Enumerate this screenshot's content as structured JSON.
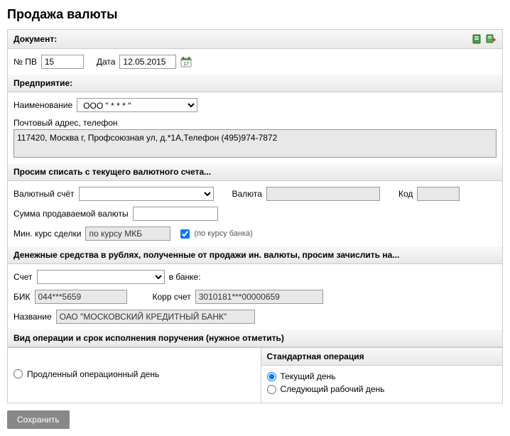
{
  "title": "Продажа валюты",
  "document": {
    "header": "Документ:",
    "numLabel": "№ ПВ",
    "numValue": "15",
    "dateLabel": "Дата",
    "dateValue": "12.05.2015"
  },
  "enterprise": {
    "header": "Предприятие:",
    "nameLabel": "Наименование",
    "nameValue": "ООО \" * * * \"",
    "addressLabel": "Почтовый адрес, телефон",
    "addressValue": "117420, Москва г, Профсоюзная ул, д.*1А,Телефон (495)974-7872"
  },
  "debit": {
    "header": "Просим списать с текущего валютного счета...",
    "accountLabel": "Валютный счёт",
    "accountValue": "",
    "currencyLabel": "Валюта",
    "currencyValue": "",
    "codeLabel": "Код",
    "codeValue": "",
    "amountLabel": "Сумма продаваемой валюты",
    "amountValue": "",
    "rateLabel": "Мин. курс сделки",
    "rateValue": "по курсу МКБ",
    "rateHint": "(по курсу банка)"
  },
  "credit": {
    "header": "Денежные средства в рублях, полученные от продажи ин. валюты, просим зачислить на...",
    "accountLabel": "Счет",
    "accountValue": "",
    "bankInLabel": "в банке:",
    "bikLabel": "БИК",
    "bikValue": "044***5659",
    "corrLabel": "Корр счет",
    "corrValue": "3010181***00000659",
    "bankNameLabel": "Название",
    "bankNameValue": "ОАО \"МОСКОВСКИЙ КРЕДИТНЫЙ БАНК\""
  },
  "operation": {
    "header": "Вид операции и срок исполнения поручения (нужное отметить)",
    "extendedLabel": "Продленный операционный день",
    "standardHeader": "Стандартная операция",
    "currentDayLabel": "Текущий день",
    "nextDayLabel": "Следующий рабочий день"
  },
  "saveButton": "Сохранить"
}
